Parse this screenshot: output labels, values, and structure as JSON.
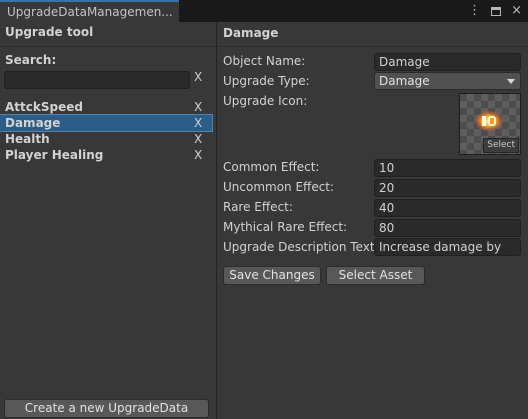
{
  "window": {
    "tab_title": "UpgradeDataManagemen...",
    "menu_icon": "kebab-menu-icon",
    "maximize_icon": "maximize-icon",
    "close_glyph": "×"
  },
  "left_panel": {
    "title": "Upgrade tool",
    "search_label": "Search:",
    "search_value": "",
    "search_clear": "X",
    "items": [
      {
        "label": "AttckSpeed",
        "remove": "X",
        "selected": false
      },
      {
        "label": "Damage",
        "remove": "X",
        "selected": true
      },
      {
        "label": "Health",
        "remove": "X",
        "selected": false
      },
      {
        "label": "Player Healing",
        "remove": "X",
        "selected": false
      }
    ],
    "create_button": "Create a new UpgradeData"
  },
  "detail": {
    "title": "Damage",
    "fields": {
      "object_name": {
        "label": "Object Name:",
        "value": "Damage"
      },
      "upgrade_type": {
        "label": "Upgrade Type:",
        "value": "Damage"
      },
      "upgrade_icon": {
        "label": "Upgrade Icon:",
        "select": "Select"
      },
      "common_effect": {
        "label": "Common Effect:",
        "value": "10"
      },
      "uncommon_effect": {
        "label": "Uncommon Effect:",
        "value": "20"
      },
      "rare_effect": {
        "label": "Rare Effect:",
        "value": "40"
      },
      "mythical_rare_effect": {
        "label": "Mythical Rare Effect:",
        "value": "80"
      },
      "description": {
        "label": "Upgrade Description Text:",
        "value": "Increase damage by"
      }
    },
    "buttons": {
      "save": "Save Changes",
      "select_asset": "Select Asset"
    }
  },
  "colors": {
    "background": "#383838",
    "selection": "#2c5d87",
    "tab_accent": "#3a72b0",
    "icon_glow": "#ffb21a"
  }
}
